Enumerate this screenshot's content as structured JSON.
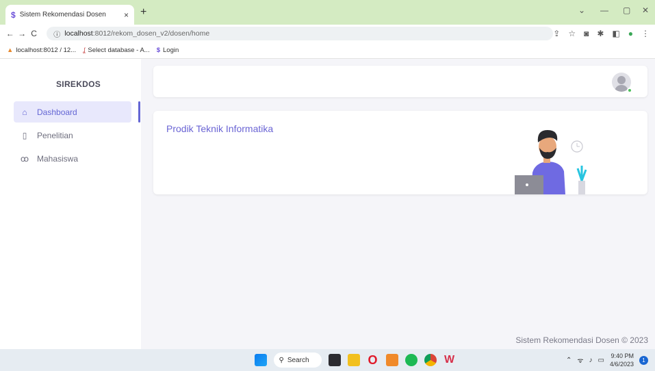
{
  "browser": {
    "tab_title": "Sistem Rekomendasi Dosen",
    "tab_close": "×",
    "new_tab": "+",
    "url_host": "localhost",
    "url_rest": ":8012/rekom_dosen_v2/dosen/home",
    "bookmarks": [
      "localhost:8012 / 12...",
      "Select database - A...",
      "Login"
    ]
  },
  "sidebar": {
    "brand": "SIREKDOS",
    "items": [
      {
        "label": "Dashboard",
        "icon": "home-icon",
        "active": true
      },
      {
        "label": "Penelitian",
        "icon": "file-icon",
        "active": false
      },
      {
        "label": "Mahasiswa",
        "icon": "users-icon",
        "active": false
      }
    ]
  },
  "main": {
    "welcome_title": "Prodik Teknik Informatika",
    "footer": "Sistem Rekomendasi Dosen © 2023"
  },
  "taskbar": {
    "search_label": "Search",
    "time": "9:40 PM",
    "date": "4/6/2023",
    "notification_count": "1"
  },
  "colors": {
    "accent": "#6466d4",
    "active_bg": "#e8e8fc",
    "tab_strip": "#d4ebc2"
  }
}
